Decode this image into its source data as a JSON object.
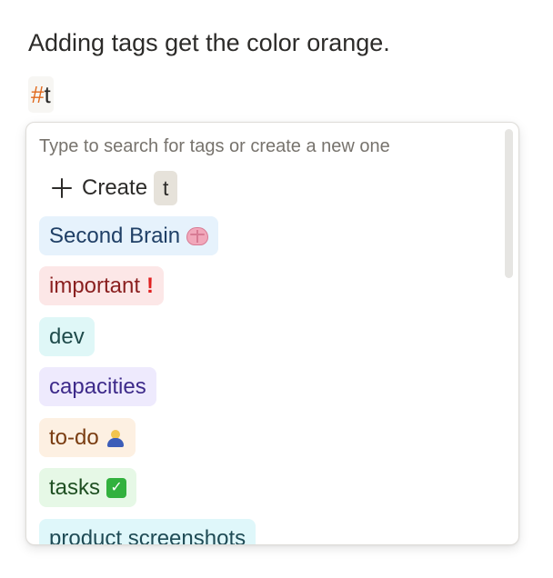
{
  "heading": "Adding tags get the color orange.",
  "tag_input": {
    "hash": "#",
    "typed": "t"
  },
  "dropdown": {
    "search_hint": "Type to search for tags or create a new one",
    "create": {
      "label": "Create",
      "value": "t"
    },
    "tags": [
      {
        "label": "Second Brain",
        "icon": "brain-icon",
        "bg": "#e6f2fc",
        "fg": "#1f3f66"
      },
      {
        "label": "important",
        "icon": "exclamation-icon",
        "bg": "#fce7e7",
        "fg": "#8a1f1f"
      },
      {
        "label": "dev",
        "icon": "",
        "bg": "#dff7f7",
        "fg": "#1f4b4b"
      },
      {
        "label": "capacities",
        "icon": "",
        "bg": "#eeeafd",
        "fg": "#3d2a8a"
      },
      {
        "label": "to-do",
        "icon": "person-bowing-icon",
        "bg": "#fdf0e2",
        "fg": "#7a3d12"
      },
      {
        "label": "tasks",
        "icon": "check-mark-button-icon",
        "bg": "#e6f8e6",
        "fg": "#1f4f22"
      },
      {
        "label": "product screenshots",
        "icon": "",
        "bg": "#dff7fa",
        "fg": "#1f4b55"
      }
    ]
  },
  "colors": {
    "hash_accent": "#e0691d",
    "create_chip_bg": "#e6e2da"
  }
}
